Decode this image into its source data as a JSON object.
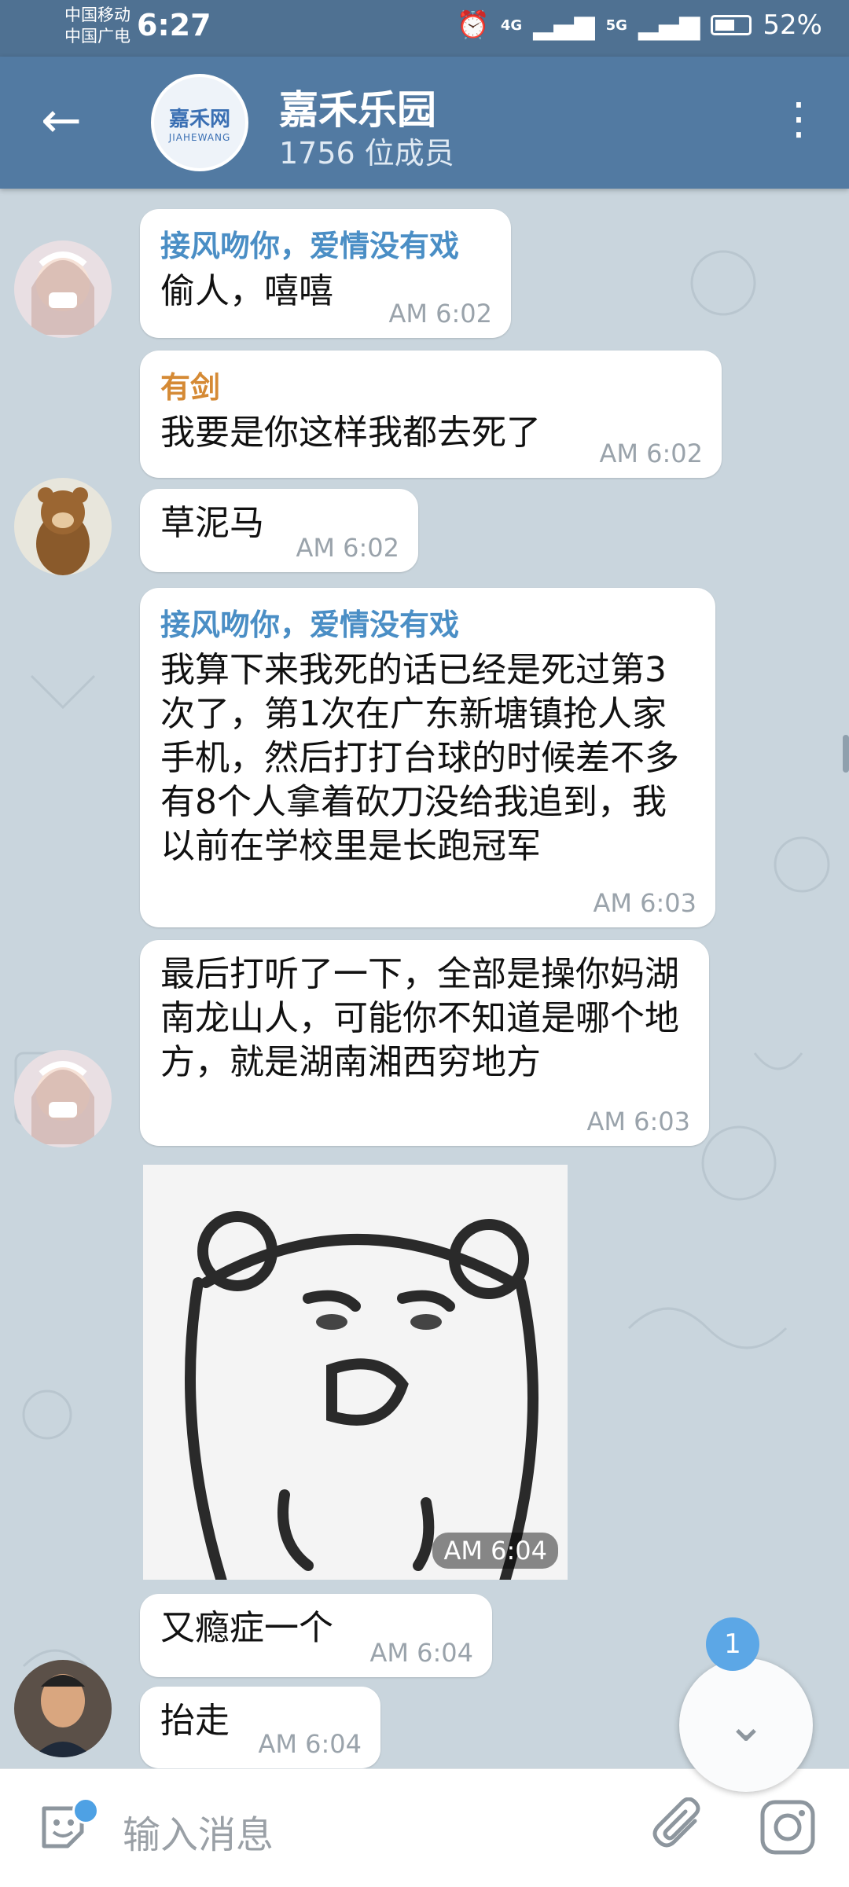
{
  "status_bar": {
    "carrier_1": "中国移动",
    "carrier_2": "中国广电",
    "time": "6:27",
    "net_1": "4G",
    "net_2": "5G",
    "battery": "52%"
  },
  "header": {
    "back_icon": "arrow-left-icon",
    "avatar_text": "嘉禾网",
    "avatar_sub": "JIAHEWANG",
    "title": "嘉禾乐园",
    "subtitle": "1756 位成员",
    "menu_icon": "more-vertical-icon"
  },
  "messages": [
    {
      "sender": "接风吻你，爱情没有戏",
      "text": "偷人，嘻嘻",
      "time": "AM 6:02"
    },
    {
      "sender": "有剑",
      "text": "我要是你这样我都去死了",
      "time": "AM 6:02"
    },
    {
      "text": "草泥马",
      "time": "AM 6:02"
    },
    {
      "sender": "接风吻你，爱情没有戏",
      "text": "我算下来我死的话已经是死过第3次了，第1次在广东新塘镇抢人家手机，然后打打台球的时候差不多有8个人拿着砍刀没给我追到，我以前在学校里是长跑冠军",
      "time": "AM 6:03"
    },
    {
      "text": "最后打听了一下，全部是操你妈湖南龙山人，可能你不知道是哪个地方，就是湖南湘西穷地方",
      "time": "AM 6:03"
    },
    {
      "text": "又瘾症一个",
      "time": "AM 6:04"
    },
    {
      "text": "抬走",
      "time": "AM 6:04"
    }
  ],
  "sticker": {
    "time": "AM 6:04"
  },
  "scroll_down": {
    "badge": "1",
    "icon": "chevron-down-icon"
  },
  "input": {
    "placeholder": "输入消息",
    "emoji_icon": "sticker-icon",
    "attach_icon": "paperclip-icon",
    "camera_icon": "instagram-camera-icon"
  },
  "colors": {
    "status_bar": "#4f7192",
    "header": "#527aa2",
    "chat_bg": "#c9d5dd",
    "sender_blue": "#4a8ec5",
    "sender_orange": "#d58a35",
    "badge": "#5ca7e6"
  }
}
